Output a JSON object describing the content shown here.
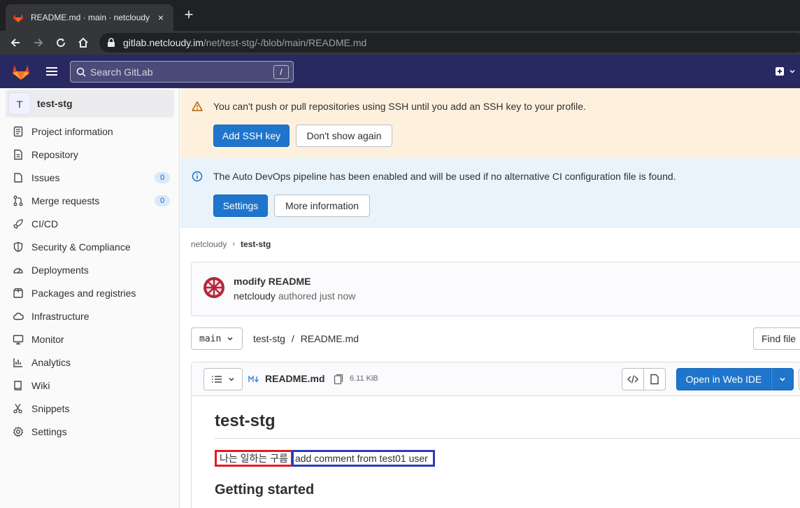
{
  "browser": {
    "tab_title": "README.md · main · netcloudy",
    "tab_close": "×",
    "new_tab": "+",
    "url_host": "gitlab.netcloudy.im",
    "url_path": "/net/test-stg/-/blob/main/README.md"
  },
  "header": {
    "search_placeholder": "Search GitLab",
    "search_shortcut": "/"
  },
  "sidebar": {
    "project_initial": "T",
    "project_name": "test-stg",
    "items": [
      {
        "label": "Project information",
        "icon": "info-icon"
      },
      {
        "label": "Repository",
        "icon": "doc-icon"
      },
      {
        "label": "Issues",
        "icon": "issues-icon",
        "badge": "0"
      },
      {
        "label": "Merge requests",
        "icon": "merge-request-icon",
        "badge": "0"
      },
      {
        "label": "CI/CD",
        "icon": "rocket-icon"
      },
      {
        "label": "Security & Compliance",
        "icon": "shield-icon"
      },
      {
        "label": "Deployments",
        "icon": "deployments-icon"
      },
      {
        "label": "Packages and registries",
        "icon": "package-icon"
      },
      {
        "label": "Infrastructure",
        "icon": "cloud-icon"
      },
      {
        "label": "Monitor",
        "icon": "monitor-icon"
      },
      {
        "label": "Analytics",
        "icon": "chart-icon"
      },
      {
        "label": "Wiki",
        "icon": "book-icon"
      },
      {
        "label": "Snippets",
        "icon": "scissors-icon"
      },
      {
        "label": "Settings",
        "icon": "gear-icon"
      }
    ]
  },
  "alerts": {
    "ssh": {
      "text": "You can't push or pull repositories using SSH until you add an SSH key to your profile.",
      "primary": "Add SSH key",
      "secondary": "Don't show again"
    },
    "devops": {
      "text": "The Auto DevOps pipeline has been enabled and will be used if no alternative CI configuration file is found.",
      "primary": "Settings",
      "secondary": "More information"
    }
  },
  "breadcrumb": {
    "group": "netcloudy",
    "project": "test-stg"
  },
  "commit": {
    "title": "modify README",
    "author": "netcloudy",
    "meta": "authored just now"
  },
  "repo_nav": {
    "branch": "main",
    "path_root": "test-stg",
    "path_sep": "/",
    "path_file": "README.md",
    "find_file": "Find file"
  },
  "file": {
    "name": "README.md",
    "size": "6.11 KiB",
    "open_ide": "Open in Web IDE"
  },
  "readme": {
    "title": "test-stg",
    "korean_text": "나는 일하는 구름",
    "comment_text": "add comment from test01 user",
    "section_heading": "Getting started"
  },
  "colors": {
    "header_bg": "#292961",
    "primary": "#1f75cb",
    "warning_bg": "#fdf1dd",
    "info_bg": "#e9f3fc",
    "highlight_red": "#e21d24",
    "highlight_blue": "#2f3bb5"
  }
}
